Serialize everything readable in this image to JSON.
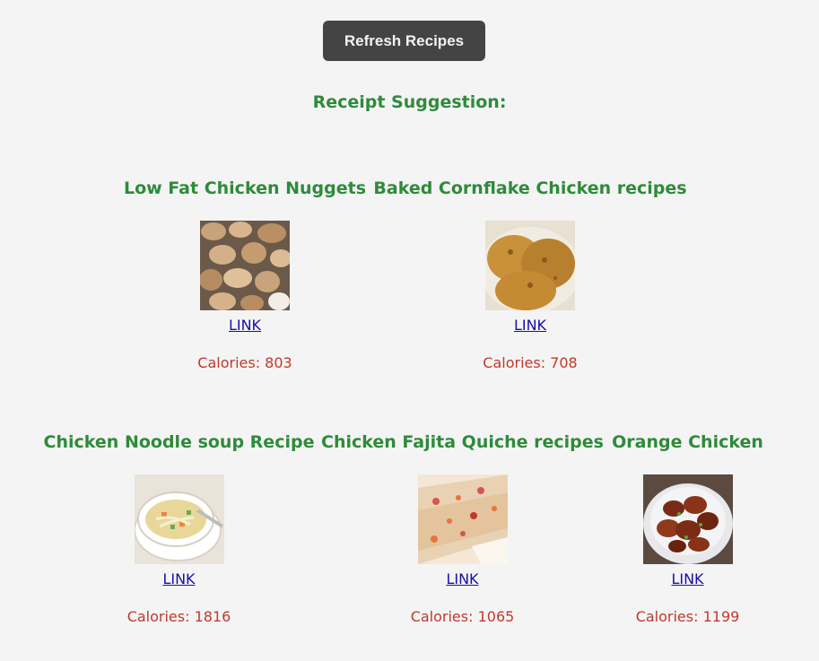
{
  "toolbar": {
    "refresh_label": "Refresh Recipes"
  },
  "section": {
    "title": "Receipt Suggestion:"
  },
  "recipes": [
    {
      "title": "Low Fat Chicken Nuggets",
      "image": "chicken-nuggets-photo",
      "link": "LINK",
      "calories": "Calories: 803"
    },
    {
      "title": "Baked Cornflake Chicken recipes",
      "image": "cornflake-chicken-photo",
      "link": "LINK",
      "calories": "Calories: 708"
    },
    {
      "title": "Chicken Noodle soup Recipe",
      "image": "noodle-soup-photo",
      "link": "LINK",
      "calories": "Calories: 1816"
    },
    {
      "title": "Chicken Fajita Quiche recipes",
      "image": "fajita-quiche-photo",
      "link": "LINK",
      "calories": "Calories: 1065"
    },
    {
      "title": "Orange Chicken",
      "image": "orange-chicken-photo",
      "link": "LINK",
      "calories": "Calories: 1199"
    }
  ]
}
